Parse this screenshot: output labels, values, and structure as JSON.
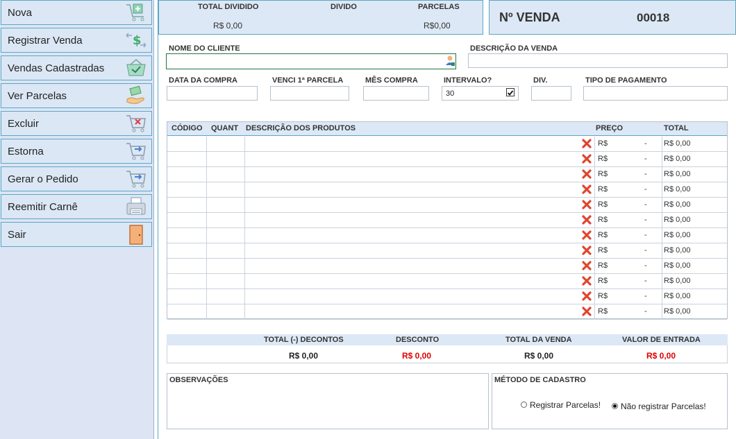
{
  "sidebar": {
    "items": [
      {
        "label": "Nova",
        "icon": "cart-add-icon"
      },
      {
        "label": "Registrar Venda",
        "icon": "money-exchange-icon"
      },
      {
        "label": "Vendas Cadastradas",
        "icon": "basket-check-icon"
      },
      {
        "label": "Ver Parcelas",
        "icon": "hand-money-icon"
      },
      {
        "label": "Excluir",
        "icon": "cart-remove-icon"
      },
      {
        "label": "Estorna",
        "icon": "cart-return-icon"
      },
      {
        "label": "Gerar o Pedido",
        "icon": "cart-forward-icon"
      },
      {
        "label": "Reemitir Carnê",
        "icon": "printer-icon"
      },
      {
        "label": "Sair",
        "icon": "door-icon"
      }
    ]
  },
  "summary": {
    "total_dividido_label": "TOTAL DIVIDIDO",
    "total_dividido_value": "R$ 0,00",
    "divido_label": "DIVIDO",
    "parcelas_label": "PARCELAS",
    "parcelas_value": "R$0,00"
  },
  "venda": {
    "label": "Nº VENDA",
    "number": "00018"
  },
  "form": {
    "nome_cliente_label": "NOME DO CLIENTE",
    "nome_cliente_value": "",
    "descricao_label": "DESCRIÇÃO DA VENDA",
    "descricao_value": "",
    "data_compra_label": "DATA DA COMPRA",
    "venci_label": "VENCI 1ª PARCELA",
    "mes_compra_label": "MÊS COMPRA",
    "intervalo_label": "INTERVALO?",
    "intervalo_value": "30",
    "intervalo_checked": true,
    "div_label": "DIV.",
    "tipo_pagamento_label": "TIPO DE PAGAMENTO"
  },
  "table": {
    "headers": [
      "CÓDIGO",
      "QUANT",
      "DESCRIÇÃO DOS PRODUTOS",
      "PREÇO",
      "TOTAL"
    ],
    "rows": [
      {
        "codigo": "",
        "quant": "",
        "descricao": "",
        "preco_currency": "R$",
        "preco_value": "-",
        "total": "R$ 0,00"
      },
      {
        "codigo": "",
        "quant": "",
        "descricao": "",
        "preco_currency": "R$",
        "preco_value": "-",
        "total": "R$ 0,00"
      },
      {
        "codigo": "",
        "quant": "",
        "descricao": "",
        "preco_currency": "R$",
        "preco_value": "-",
        "total": "R$ 0,00"
      },
      {
        "codigo": "",
        "quant": "",
        "descricao": "",
        "preco_currency": "R$",
        "preco_value": "-",
        "total": "R$ 0,00"
      },
      {
        "codigo": "",
        "quant": "",
        "descricao": "",
        "preco_currency": "R$",
        "preco_value": "-",
        "total": "R$ 0,00"
      },
      {
        "codigo": "",
        "quant": "",
        "descricao": "",
        "preco_currency": "R$",
        "preco_value": "-",
        "total": "R$ 0,00"
      },
      {
        "codigo": "",
        "quant": "",
        "descricao": "",
        "preco_currency": "R$",
        "preco_value": "-",
        "total": "R$ 0,00"
      },
      {
        "codigo": "",
        "quant": "",
        "descricao": "",
        "preco_currency": "R$",
        "preco_value": "-",
        "total": "R$ 0,00"
      },
      {
        "codigo": "",
        "quant": "",
        "descricao": "",
        "preco_currency": "R$",
        "preco_value": "-",
        "total": "R$ 0,00"
      },
      {
        "codigo": "",
        "quant": "",
        "descricao": "",
        "preco_currency": "R$",
        "preco_value": "-",
        "total": "R$ 0,00"
      },
      {
        "codigo": "",
        "quant": "",
        "descricao": "",
        "preco_currency": "R$",
        "preco_value": "-",
        "total": "R$ 0,00"
      },
      {
        "codigo": "",
        "quant": "",
        "descricao": "",
        "preco_currency": "R$",
        "preco_value": "-",
        "total": "R$ 0,00"
      }
    ]
  },
  "totals": {
    "total_descontos_label": "TOTAL (-) DECONTOS",
    "total_descontos_value": "R$ 0,00",
    "desconto_label": "DESCONTO",
    "desconto_value": "R$ 0,00",
    "total_venda_label": "TOTAL DA VENDA",
    "total_venda_value": "R$ 0,00",
    "valor_entrada_label": "VALOR DE ENTRADA",
    "valor_entrada_value": "R$ 0,00"
  },
  "observacoes": {
    "label": "OBSERVAÇÕES",
    "value": ""
  },
  "metodo": {
    "label": "MÉTODO DE CADASTRO",
    "options": [
      {
        "label": "Registrar Parcelas!",
        "selected": false
      },
      {
        "label": "Não registrar Parcelas!",
        "selected": true
      }
    ]
  },
  "colors": {
    "accent": "#5aa7c7",
    "header_bg": "#dce8f5",
    "sidebar_bg": "#dde4f3",
    "red": "#e00000"
  }
}
